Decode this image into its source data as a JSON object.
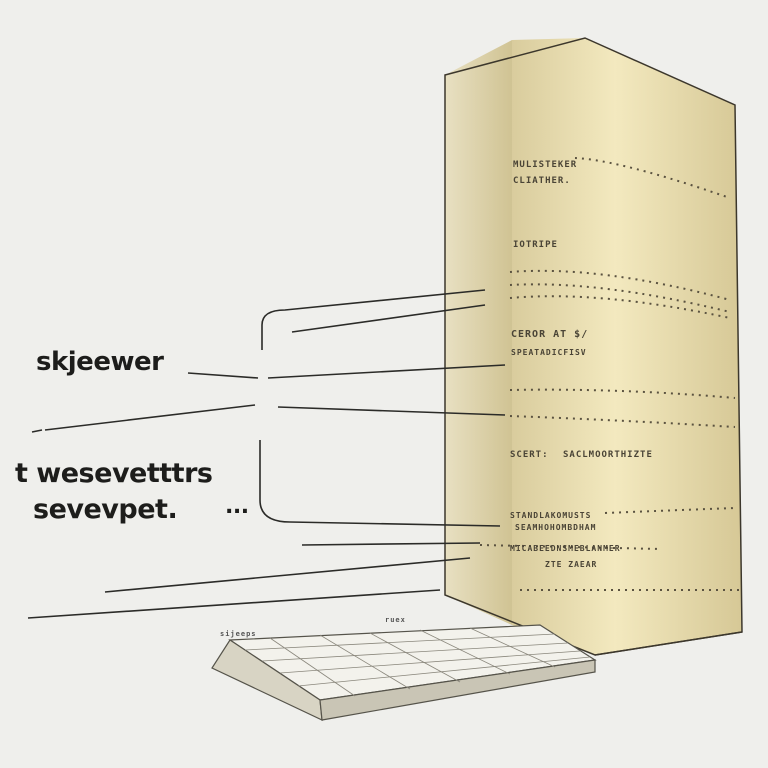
{
  "labels": {
    "label_1": "skjeewer",
    "label_2": "t wesevetttrs",
    "label_3": "sevevpet.",
    "label_3_suffix": "..."
  },
  "tower_text": [
    "MULISTEKER",
    "CLIATHER.",
    "IOTRIPE",
    "CEROR AT $/",
    "SPEATADICFISV",
    "SCERT:",
    "SACLMOORTHIZTE",
    "STANDLAKOMUSTS",
    "SEAMHOHOMBDHAM",
    "MICABEEDNSMEBLANMER",
    "ZTE ZAEAR"
  ],
  "keyboard_text": [
    "sijeeps",
    "ruex"
  ],
  "colors": {
    "background": "#efefec",
    "tower_light": "#f2e8bd",
    "tower_dark": "#c9bb8c",
    "ink": "#1d1d1b"
  }
}
